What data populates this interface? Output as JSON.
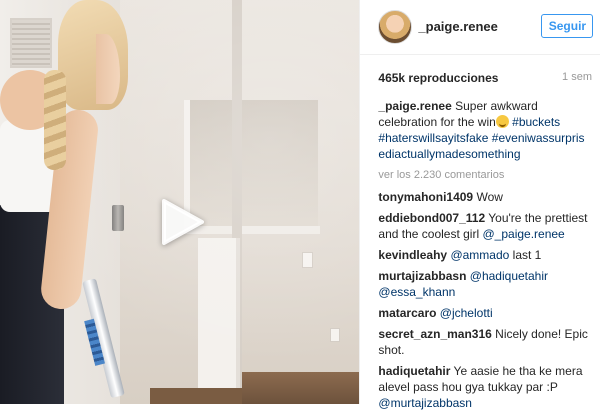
{
  "post": {
    "username": "_paige.renee",
    "follow_label": "Seguir",
    "views": "465k reproducciones",
    "age": "1 sem",
    "caption": {
      "user": "_paige.renee",
      "text_before": "Super awkward celebration for the win",
      "emoji": "grinning-emoji",
      "tags": [
        "#buckets",
        "#haterswillsayitsfake",
        "#eveniwassurprisediactuallymadesomething"
      ]
    },
    "view_all_comments": "ver los 2.230 comentarios"
  },
  "comments": [
    {
      "user": "tonymahoni1409",
      "text": "Wow"
    },
    {
      "user": "eddiebond007_112",
      "text": "You're the prettiest and the coolest girl",
      "mention": "@_paige.renee"
    },
    {
      "user": "kevindleahy",
      "mention": "@ammado",
      "text": "last 1"
    },
    {
      "user": "murtajizabbasn",
      "mention": "@hadiquetahir",
      "mention2": "@essa_khann"
    },
    {
      "user": "matarcaro",
      "mention": "@jchelotti"
    },
    {
      "user": "secret_azn_man316",
      "text": "Nicely done! Epic shot."
    },
    {
      "user": "hadiquetahir",
      "text": "Ye aasie he tha ke mera alevel pass hou gya tukkay par :P",
      "mention": "@murtajizabbasn"
    }
  ],
  "icons": {
    "play": "play-icon",
    "avatar": "avatar"
  }
}
